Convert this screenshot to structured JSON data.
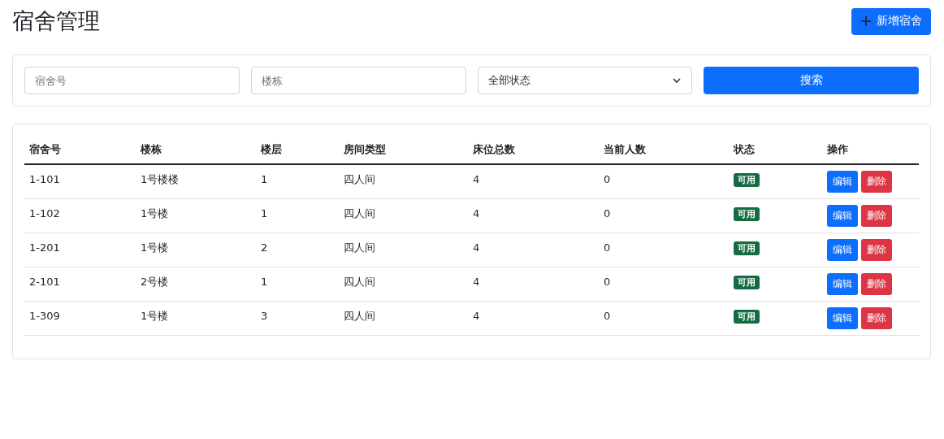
{
  "page_title": "宿舍管理",
  "add_button": "新增宿舍",
  "filters": {
    "room_field": {
      "placeholder": "宿舍号"
    },
    "building_field": {
      "placeholder": "楼栋"
    },
    "status_select": {
      "value": "全部状态"
    },
    "search_button": "搜索"
  },
  "table": {
    "columns": [
      "宿舍号",
      "楼栋",
      "楼层",
      "房间类型",
      "床位总数",
      "当前人数",
      "状态",
      "操作"
    ],
    "rows": [
      {
        "cells": [
          "1-101",
          "1号楼楼",
          "1",
          "四人间",
          "4",
          "0"
        ],
        "status": "可用",
        "actions": [
          "编辑",
          "删除"
        ]
      },
      {
        "cells": [
          "1-102",
          "1号楼",
          "1",
          "四人间",
          "4",
          "0"
        ],
        "status": "可用",
        "actions": [
          "编辑",
          "删除"
        ]
      },
      {
        "cells": [
          "1-201",
          "1号楼",
          "2",
          "四人间",
          "4",
          "0"
        ],
        "status": "可用",
        "actions": [
          "编辑",
          "删除"
        ]
      },
      {
        "cells": [
          "2-101",
          "2号楼",
          "1",
          "四人间",
          "4",
          "0"
        ],
        "status": "可用",
        "actions": [
          "编辑",
          "删除"
        ]
      },
      {
        "cells": [
          "1-309",
          "1号楼",
          "3",
          "四人间",
          "4",
          "0"
        ],
        "status": "可用",
        "actions": [
          "编辑",
          "删除"
        ]
      }
    ]
  }
}
